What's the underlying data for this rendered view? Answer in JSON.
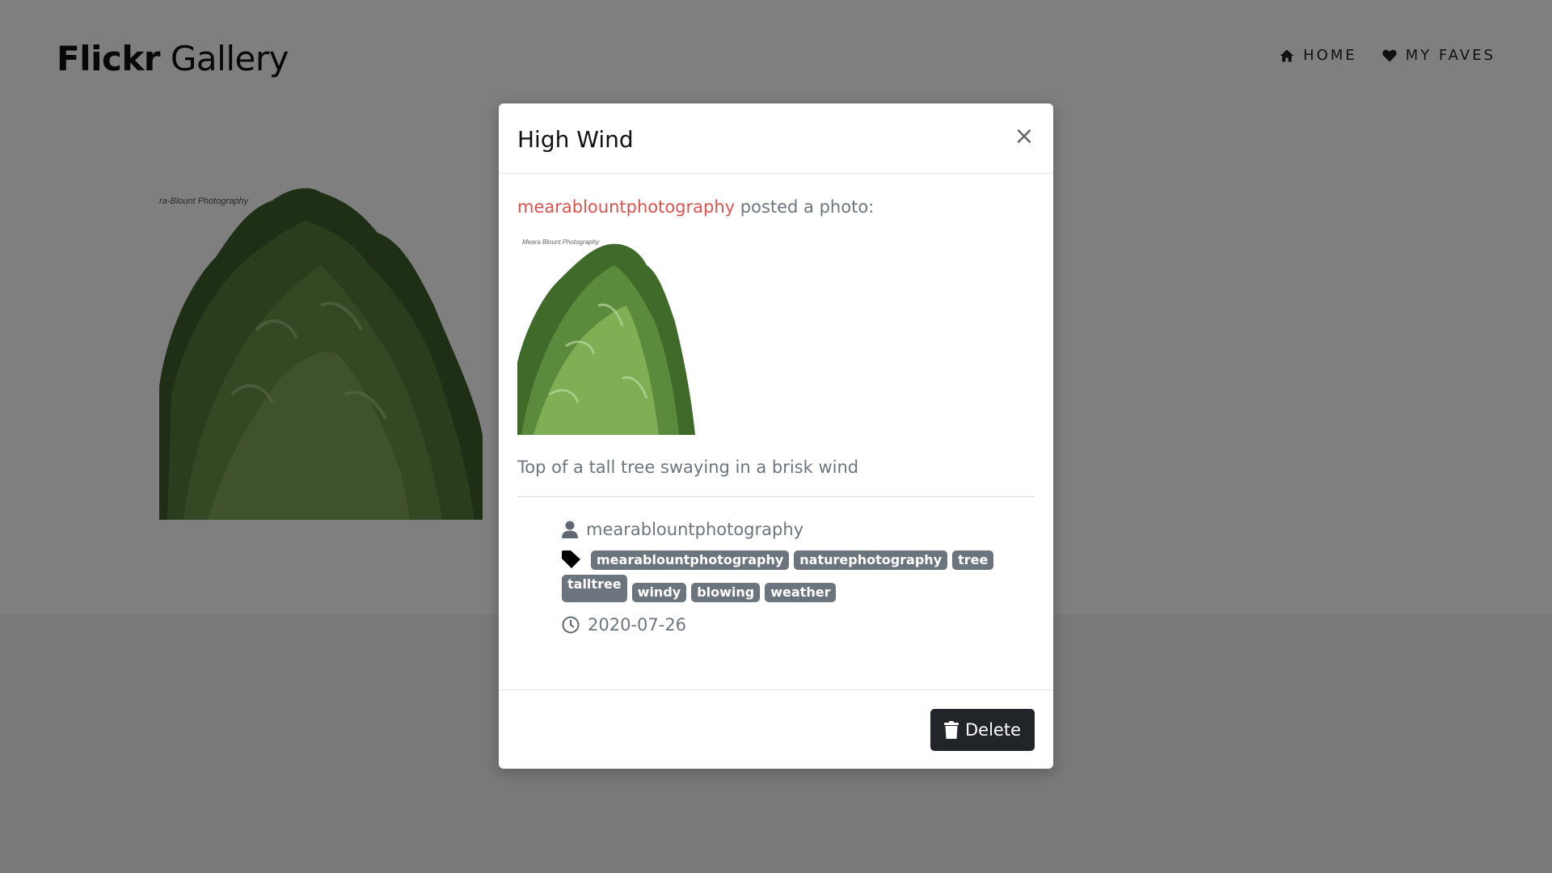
{
  "header": {
    "brand_bold": "Flickr",
    "brand_light": "Gallery",
    "nav": [
      {
        "label": "HOME",
        "icon": "home-icon"
      },
      {
        "label": "MY FAVES",
        "icon": "heart-icon"
      }
    ]
  },
  "gallery": {
    "thumb_watermark": "ra-Blount Photography"
  },
  "modal": {
    "title": "High Wind",
    "close_label": "×",
    "author_link": "mearablountphotography",
    "posted_suffix": " posted a photo:",
    "photo_watermark": "Meara Blount Photography",
    "description": "Top of a tall tree swaying in a brisk wind",
    "owner": "mearablountphotography",
    "tags": [
      "mearablountphotography",
      "naturephotography",
      "tree",
      "talltree",
      "windy",
      "blowing",
      "weather"
    ],
    "date": "2020-07-26",
    "delete_label": "Delete"
  },
  "colors": {
    "link": "#d9534f",
    "muted_text": "#6c757d",
    "tag_bg": "#6c757d",
    "button_bg": "#212529",
    "overlay": "rgba(0,0,0,0.5)"
  }
}
